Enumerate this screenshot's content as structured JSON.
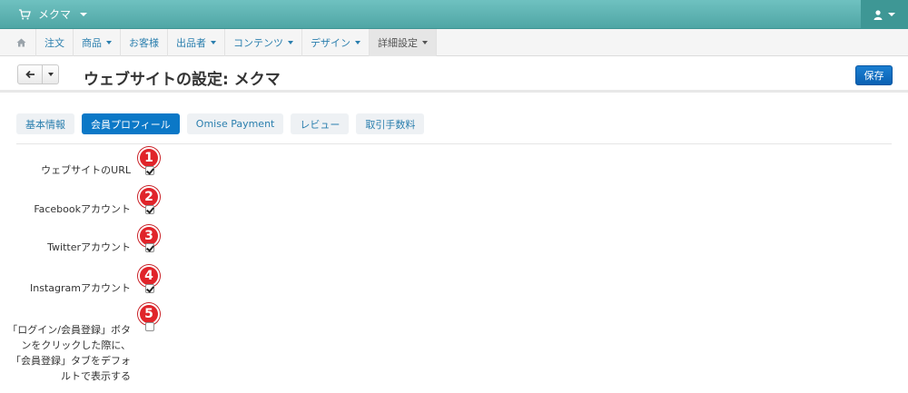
{
  "topbar": {
    "store_name": "メクマ"
  },
  "menu": {
    "items": [
      {
        "label": "注文",
        "caret": false
      },
      {
        "label": "商品",
        "caret": true
      },
      {
        "label": "お客様",
        "caret": false
      },
      {
        "label": "出品者",
        "caret": true
      },
      {
        "label": "コンテンツ",
        "caret": true
      },
      {
        "label": "デザイン",
        "caret": true
      },
      {
        "label": "詳細設定",
        "caret": true,
        "active": true
      }
    ]
  },
  "header": {
    "title": "ウェブサイトの設定: メクマ",
    "save_label": "保存"
  },
  "tabs": [
    {
      "label": "基本情報"
    },
    {
      "label": "会員プロフィール",
      "active": true
    },
    {
      "label": "Omise Payment"
    },
    {
      "label": "レビュー"
    },
    {
      "label": "取引手数料"
    }
  ],
  "form": {
    "fields": [
      {
        "badge": "1",
        "label": "ウェブサイトのURL",
        "checked": true
      },
      {
        "badge": "2",
        "label": "Facebookアカウント",
        "checked": true
      },
      {
        "badge": "3",
        "label": "Twitterアカウント",
        "checked": true
      },
      {
        "badge": "4",
        "label": "Instagramアカウント",
        "checked": true
      },
      {
        "badge": "5",
        "label_lines": [
          "「ログイン/会員登録」ボタ",
          "ンをクリックした際に、",
          "「会員登録」タブをデフォ",
          "ルトで表示する"
        ],
        "checked": false
      }
    ]
  },
  "colors": {
    "accent": "#0b78c7",
    "topbar": "#5fb3b2",
    "badge": "#e0242a"
  }
}
